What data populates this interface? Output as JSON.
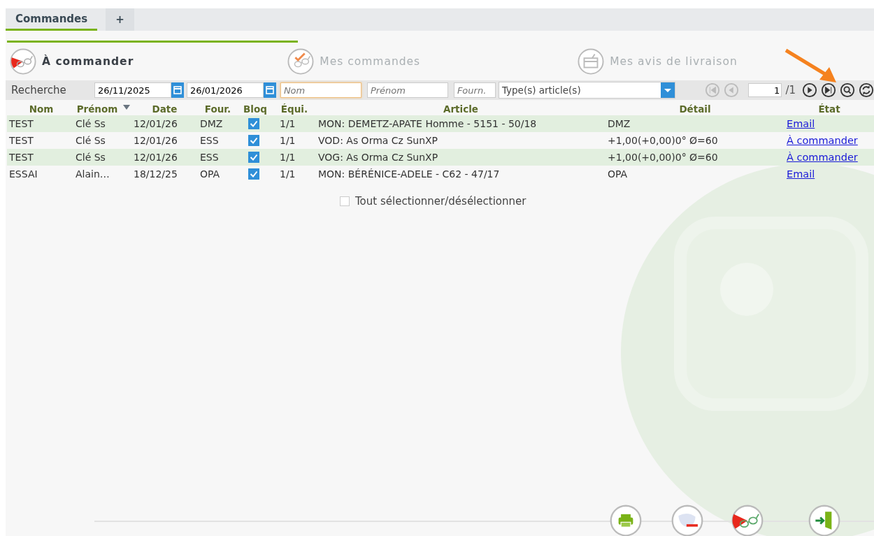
{
  "tabs": [
    {
      "label": "Commandes",
      "selected": true
    },
    {
      "label": "+",
      "selected": false
    }
  ],
  "sections": [
    {
      "label": "À commander",
      "selected": true
    },
    {
      "label": "Mes commandes",
      "selected": false
    },
    {
      "label": "Mes avis de livraison",
      "selected": false
    }
  ],
  "search": {
    "label": "Recherche",
    "date_from": "26/11/2025",
    "date_to": "26/01/2026",
    "nom_placeholder": "Nom",
    "prenom_placeholder": "Prénom",
    "fourn_placeholder": "Fourn.",
    "article_type": "Type(s) article(s)"
  },
  "pager": {
    "page": "1",
    "total": "/1"
  },
  "columns": [
    {
      "label": "Nom",
      "sorted": false
    },
    {
      "label": "Prénom",
      "sorted": true
    },
    {
      "label": "Date",
      "sorted": false
    },
    {
      "label": "Four.",
      "sorted": false
    },
    {
      "label": "Bloq",
      "sorted": false
    },
    {
      "label": "Équi.",
      "sorted": false
    },
    {
      "label": "Article",
      "sorted": false
    },
    {
      "label": "Détail",
      "sorted": false
    },
    {
      "label": "État",
      "sorted": false
    }
  ],
  "rows": [
    {
      "nom": "TEST",
      "prenom": "Clé Ss",
      "date": "12/01/26",
      "four": "DMZ",
      "bloq": true,
      "equi": "1/1",
      "article": "MON: DEMETZ-APATE Homme - 5151 - 50/18",
      "detail": "DMZ",
      "etat": "Email"
    },
    {
      "nom": "TEST",
      "prenom": "Clé Ss",
      "date": "12/01/26",
      "four": "ESS",
      "bloq": true,
      "equi": "1/1",
      "article": "VOD: As Orma Cz SunXP",
      "detail": "+1,00(+0,00)0° Ø=60",
      "etat": "À commander"
    },
    {
      "nom": "TEST",
      "prenom": "Clé Ss",
      "date": "12/01/26",
      "four": "ESS",
      "bloq": true,
      "equi": "1/1",
      "article": "VOG: As Orma Cz SunXP",
      "detail": "+1,00(+0,00)0° Ø=60",
      "etat": "À commander"
    },
    {
      "nom": "ESSAI",
      "prenom": "Alain…",
      "date": "18/12/25",
      "four": "OPA",
      "bloq": true,
      "equi": "1/1",
      "article": "MON: BÉRÉNICE-ADELE - C62 - 47/17",
      "detail": "OPA",
      "etat": "Email"
    }
  ],
  "select_all": {
    "label": "Tout sélectionner/désélectionner",
    "checked": false
  }
}
